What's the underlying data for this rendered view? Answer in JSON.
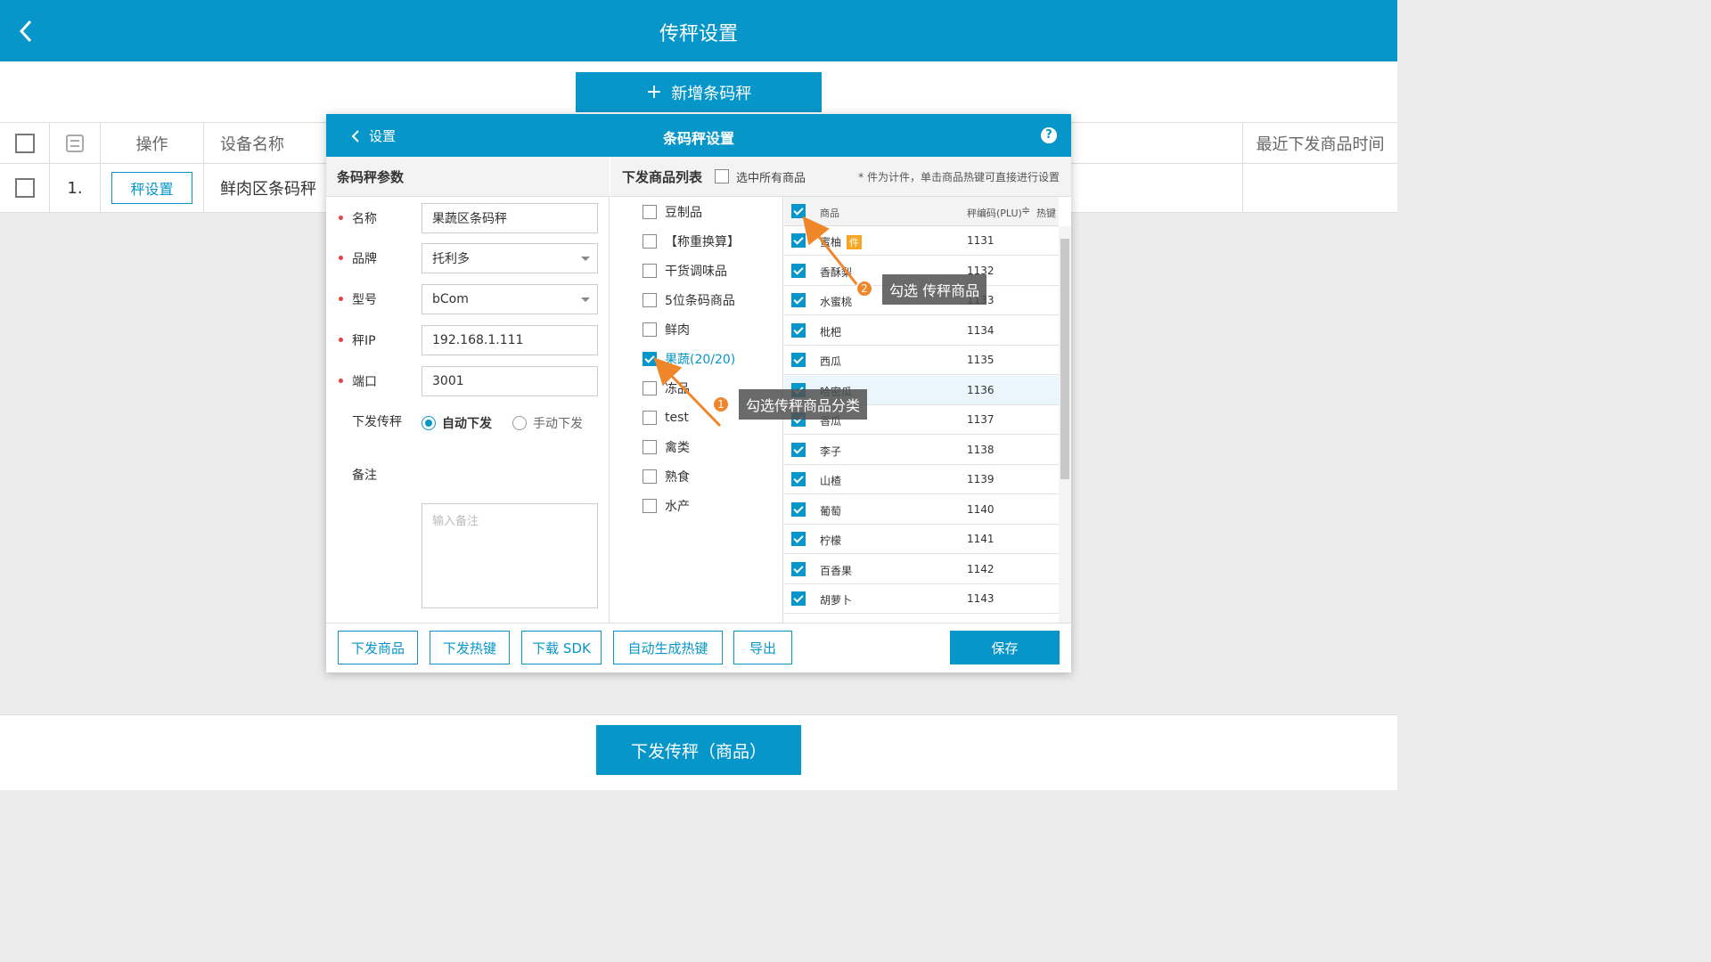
{
  "header": {
    "title": "传秤设置"
  },
  "toolbar": {
    "add_label": "新增条码秤"
  },
  "table": {
    "columns": [
      "操作",
      "设备名称",
      "最近下发商品时间"
    ],
    "rows": [
      {
        "index": "1.",
        "action": "秤设置",
        "name": "鲜肉区条码秤"
      }
    ]
  },
  "footer": {
    "send_label": "下发传秤（商品）"
  },
  "modal": {
    "back_label": "设置",
    "title": "条码秤设置",
    "help": "?",
    "params_title": "条码秤参数",
    "fields": {
      "name_label": "名称",
      "name_value": "果蔬区条码秤",
      "brand_label": "品牌",
      "brand_value": "托利多",
      "model_label": "型号",
      "model_value": "bCom",
      "ip_label": "秤IP",
      "ip_value": "192.168.1.111",
      "port_label": "端口",
      "port_value": "3001",
      "mode_label": "下发传秤",
      "mode_auto": "自动下发",
      "mode_manual": "手动下发",
      "remark_label": "备注",
      "remark_placeholder": "输入备注"
    },
    "list_title": "下发商品列表",
    "select_all": "选中所有商品",
    "hint": "* 件为计件，单击商品热键可直接进行设置",
    "categories": [
      {
        "label": "豆制品",
        "checked": false
      },
      {
        "label": "【称重换算】",
        "checked": false
      },
      {
        "label": "干货调味品",
        "checked": false
      },
      {
        "label": "5位条码商品",
        "checked": false
      },
      {
        "label": "鲜肉",
        "checked": false
      },
      {
        "label": "果蔬(20/20)",
        "checked": true
      },
      {
        "label": "冻品",
        "checked": false
      },
      {
        "label": "test",
        "checked": false
      },
      {
        "label": "禽类",
        "checked": false
      },
      {
        "label": "熟食",
        "checked": false
      },
      {
        "label": "水产",
        "checked": false
      }
    ],
    "product_head": {
      "name": "商品",
      "plu": "秤编码(PLU)",
      "sort": "≑",
      "hotkey": "热键"
    },
    "products": [
      {
        "name": "蜜柚",
        "plu": "1131",
        "tag": "件"
      },
      {
        "name": "香酥梨",
        "plu": "1132"
      },
      {
        "name": "水蜜桃",
        "plu": "1133"
      },
      {
        "name": "枇杷",
        "plu": "1134"
      },
      {
        "name": "西瓜",
        "plu": "1135"
      },
      {
        "name": "哈密瓜",
        "plu": "1136"
      },
      {
        "name": "香瓜",
        "plu": "1137"
      },
      {
        "name": "李子",
        "plu": "1138"
      },
      {
        "name": "山楂",
        "plu": "1139"
      },
      {
        "name": "葡萄",
        "plu": "1140"
      },
      {
        "name": "柠檬",
        "plu": "1141"
      },
      {
        "name": "百香果",
        "plu": "1142"
      },
      {
        "name": "胡萝卜",
        "plu": "1143"
      }
    ],
    "buttons": {
      "send_goods": "下发商品",
      "send_hotkeys": "下发热键",
      "download_sdk": "下载 SDK",
      "auto_hotkeys": "自动生成热键",
      "export": "导出",
      "save": "保存"
    }
  },
  "callouts": [
    {
      "num": "1",
      "text": "勾选传秤商品分类"
    },
    {
      "num": "2",
      "text": "勾选 传秤商品"
    }
  ],
  "colors": {
    "primary": "#0796c9",
    "accent": "#f0862a",
    "required": "#e94040"
  }
}
